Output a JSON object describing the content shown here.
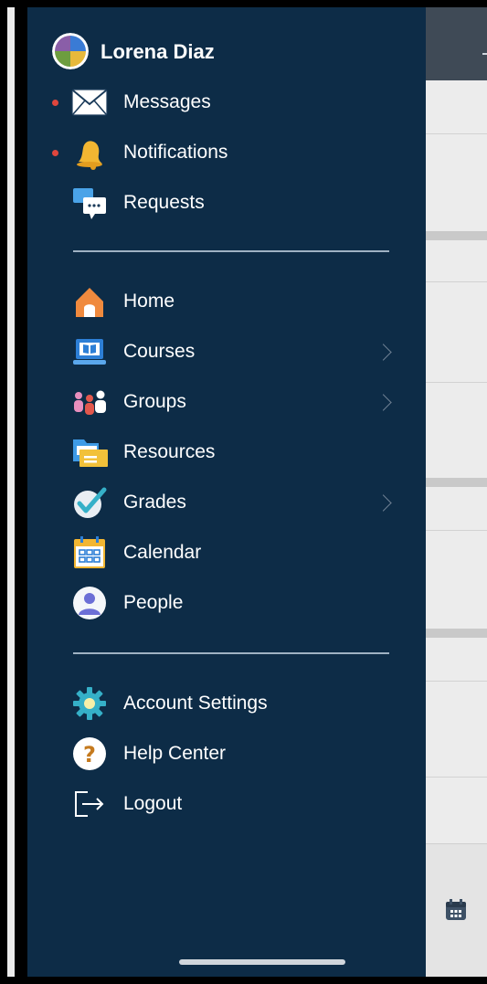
{
  "user": {
    "name": "Lorena Diaz"
  },
  "top_items": [
    {
      "label": "Messages",
      "icon": "envelope-icon",
      "unread": true
    },
    {
      "label": "Notifications",
      "icon": "bell-icon",
      "unread": true
    },
    {
      "label": "Requests",
      "icon": "chat-bubbles-icon",
      "unread": false
    }
  ],
  "nav_items": [
    {
      "label": "Home",
      "icon": "home-icon",
      "has_submenu": false
    },
    {
      "label": "Courses",
      "icon": "courses-laptop-icon",
      "has_submenu": true
    },
    {
      "label": "Groups",
      "icon": "groups-people-icon",
      "has_submenu": true
    },
    {
      "label": "Resources",
      "icon": "folder-icon",
      "has_submenu": false
    },
    {
      "label": "Grades",
      "icon": "checkmark-icon",
      "has_submenu": true
    },
    {
      "label": "Calendar",
      "icon": "calendar-icon",
      "has_submenu": false
    },
    {
      "label": "People",
      "icon": "person-icon",
      "has_submenu": false
    }
  ],
  "footer_items": [
    {
      "label": "Account Settings",
      "icon": "gear-icon"
    },
    {
      "label": "Help Center",
      "icon": "question-mark-icon"
    },
    {
      "label": "Logout",
      "icon": "logout-icon"
    }
  ],
  "colors": {
    "drawer_bg": "#0d2c47",
    "unread_dot": "#e0463d",
    "divider": "#9fb2c3"
  }
}
